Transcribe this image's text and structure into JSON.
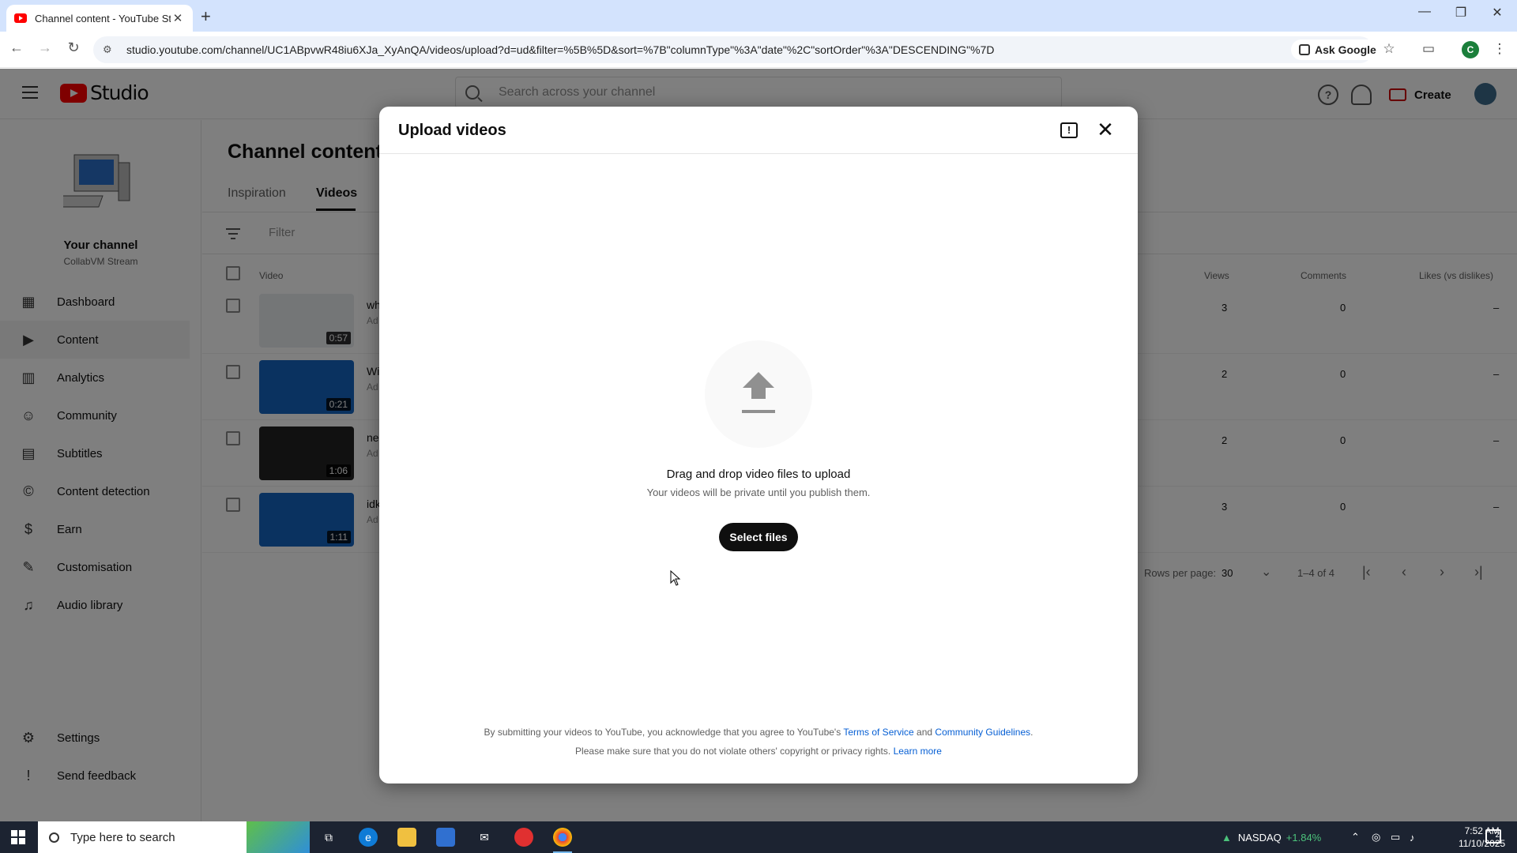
{
  "browser": {
    "tab_title": "Channel content - YouTube Stu",
    "url": "studio.youtube.com/channel/UC1ABpvwR48iu6XJa_XyAnQA/videos/upload?d=ud&filter=%5B%5D&sort=%7B\"columnType\"%3A\"date\"%2C\"sortOrder\"%3A\"DESCENDING\"%7D",
    "ask_google": "Ask Google",
    "profile_initial": "C"
  },
  "studio": {
    "logo_text": "Studio",
    "search_placeholder": "Search across your channel",
    "create_label": "Create",
    "help_icon": "?",
    "channel_name": "Your channel",
    "channel_sub": "CollabVM Stream",
    "nav": [
      {
        "label": "Dashboard",
        "icon": "dashboard-icon"
      },
      {
        "label": "Content",
        "icon": "content-icon"
      },
      {
        "label": "Analytics",
        "icon": "analytics-icon"
      },
      {
        "label": "Community",
        "icon": "community-icon"
      },
      {
        "label": "Subtitles",
        "icon": "subtitles-icon"
      },
      {
        "label": "Content detection",
        "icon": "content-detection-icon"
      },
      {
        "label": "Earn",
        "icon": "earn-icon"
      },
      {
        "label": "Customisation",
        "icon": "customisation-icon"
      },
      {
        "label": "Audio library",
        "icon": "audio-library-icon"
      }
    ],
    "nav_bottom": [
      {
        "label": "Settings",
        "icon": "settings-icon"
      },
      {
        "label": "Send feedback",
        "icon": "send-feedback-icon"
      }
    ],
    "page_title": "Channel content",
    "tabs": [
      "Inspiration",
      "Videos"
    ],
    "filter_placeholder": "Filter",
    "columns": {
      "video": "Video",
      "views": "Views",
      "comments": "Comments",
      "likes": "Likes (vs dislikes)"
    },
    "rows": [
      {
        "title": "wh",
        "sub": "Ad",
        "duration": "0:57",
        "views": "3",
        "comments": "0",
        "likes": "–"
      },
      {
        "title": "Wi",
        "sub": "Ad",
        "duration": "0:21",
        "views": "2",
        "comments": "0",
        "likes": "–"
      },
      {
        "title": "ne",
        "sub": "Ad",
        "duration": "1:06",
        "views": "2",
        "comments": "0",
        "likes": "–"
      },
      {
        "title": "idk",
        "sub": "Ad",
        "duration": "1:11",
        "views": "3",
        "comments": "0",
        "likes": "–"
      }
    ],
    "pager": {
      "rows_label": "Rows per page:",
      "rows_value": "30",
      "range": "1–4 of 4"
    }
  },
  "modal": {
    "title": "Upload videos",
    "drag_text": "Drag and drop video files to upload",
    "private_text": "Your videos will be private until you publish them.",
    "select_button": "Select files",
    "legal1_pre": "By submitting your videos to YouTube, you acknowledge that you agree to YouTube's",
    "terms_link": "Terms of Service",
    "legal1_and": "and",
    "guidelines_link": "Community Guidelines",
    "legal1_post": ".",
    "legal2_pre": "Please make sure that you do not violate others' copyright or privacy rights.",
    "learn_more": "Learn more"
  },
  "taskbar": {
    "search_placeholder": "Type here to search",
    "stock_name": "NASDAQ",
    "stock_change": "+1.84%",
    "time": "7:52 AM",
    "date": "11/10/2025",
    "notif_count": "2"
  },
  "colors": {
    "brand_red": "#ff0000",
    "link_blue": "#065fd4",
    "stock_green": "#4cc27b"
  }
}
